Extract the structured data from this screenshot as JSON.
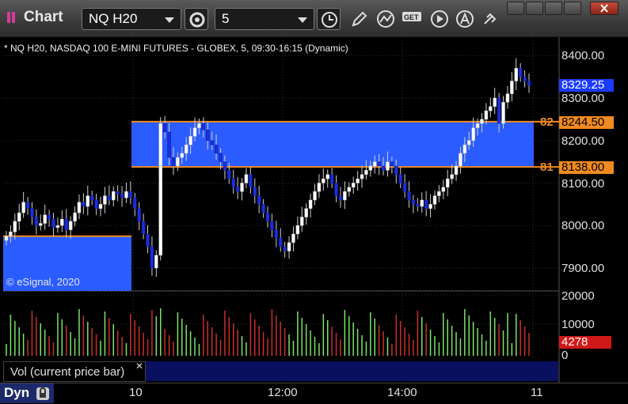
{
  "window": {
    "title": "Chart",
    "symbol": "NQ H20",
    "interval": "5"
  },
  "chart": {
    "study_line": "* NQ H20, NASDAQ 100 E-MINI FUTURES - GLOBEX, 5, 09:30-16:15 (Dynamic)",
    "copyright": "© eSignal, 2020",
    "price_labels": [
      "8400.00",
      "8300.00",
      "8200.00",
      "8100.00",
      "8000.00",
      "7900.00"
    ],
    "last_price": "8329.25",
    "level_82": {
      "label": "82",
      "value": "8244.50"
    },
    "level_81": {
      "label": "81",
      "value": "8138.00"
    },
    "volume_labels": [
      "20000",
      "10000",
      "0"
    ],
    "last_volume": "4278",
    "volume_legend": "Vol (current price bar)",
    "time_labels": [
      "10",
      "12:00",
      "14:00",
      "11"
    ],
    "mode_button": "Dyn",
    "colors": {
      "up": "#ffffff",
      "down": "#1a2fd8",
      "zone": "#2a5cff",
      "level": "#f08a20",
      "vol_up": "#7be36a",
      "vol_down": "#c8302a",
      "last_price_tag": "#1a3cff",
      "last_volume_tag": "#d01818"
    }
  },
  "chart_data": {
    "type": "candlestick",
    "ylim": [
      7870,
      8420
    ],
    "levels": [
      8244.5,
      8138.0
    ],
    "closes": [
      7975,
      7985,
      8010,
      8030,
      8055,
      8040,
      8020,
      8000,
      8005,
      8025,
      8015,
      7995,
      8000,
      8015,
      7990,
      8010,
      8030,
      8055,
      8045,
      8070,
      8060,
      8040,
      8050,
      8070,
      8060,
      8080,
      8075,
      8065,
      8080,
      8065,
      8040,
      8010,
      7980,
      7950,
      7900,
      7930,
      8240,
      8220,
      8160,
      8140,
      8160,
      8170,
      8190,
      8210,
      8230,
      8240,
      8225,
      8200,
      8190,
      8170,
      8150,
      8130,
      8110,
      8090,
      8080,
      8100,
      8120,
      8090,
      8070,
      8050,
      8030,
      8010,
      7990,
      7970,
      7950,
      7940,
      7960,
      7980,
      8000,
      8020,
      8040,
      8060,
      8080,
      8100,
      8110,
      8120,
      8100,
      8070,
      8060,
      8080,
      8090,
      8100,
      8110,
      8120,
      8130,
      8140,
      8150,
      8140,
      8130,
      8150,
      8140,
      8120,
      8100,
      8080,
      8060,
      8050,
      8045,
      8060,
      8040,
      8050,
      8070,
      8080,
      8090,
      8110,
      8120,
      8140,
      8170,
      8190,
      8200,
      8230,
      8240,
      8250,
      8270,
      8280,
      8300,
      8240,
      8290,
      8310,
      8340,
      8370,
      8350,
      8340,
      8330
    ]
  }
}
